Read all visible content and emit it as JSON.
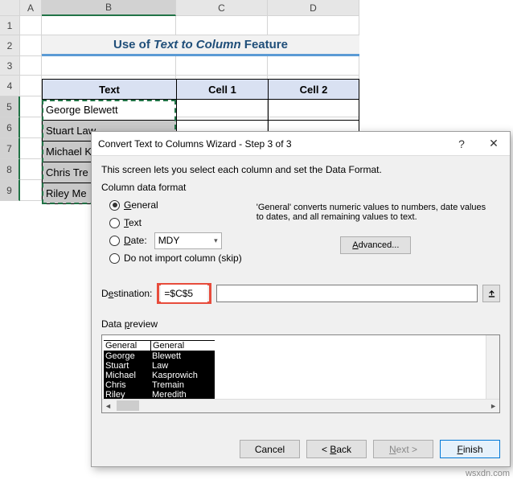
{
  "columns": {
    "a": "A",
    "b": "B",
    "c": "C",
    "d": "D"
  },
  "rows": [
    "1",
    "2",
    "3",
    "4",
    "5",
    "6",
    "7",
    "8",
    "9"
  ],
  "title": {
    "prefix": "Use of ",
    "italic": "Text to Column",
    "suffix": " Feature"
  },
  "headers": {
    "text": "Text",
    "cell1": "Cell 1",
    "cell2": "Cell 2"
  },
  "data_rows": [
    "George Blewett",
    "Stuart Law",
    "Michael Kasprowich",
    "Chris Tremain",
    "Riley Meredith"
  ],
  "data_visible": [
    "George Blewett",
    "Stuart Law",
    "Michael K",
    "Chris Tre",
    "Riley Me"
  ],
  "dialog": {
    "title": "Convert Text to Columns Wizard - Step 3 of 3",
    "help": "?",
    "close": "✕",
    "instruction": "This screen lets you select each column and set the Data Format.",
    "format_label": "Column data format",
    "radios": {
      "general": "General",
      "text": "Text",
      "date": "Date:",
      "skip": "Do not import column (skip)"
    },
    "date_value": "MDY",
    "desc": "'General' converts numeric values to numbers, date values to dates, and all remaining values to text.",
    "advanced": "Advanced...",
    "dest_label": "Destination:",
    "dest_value": "=$C$5",
    "preview_label": "Data preview",
    "preview_headers": [
      "General",
      "General"
    ],
    "preview_data": [
      [
        "George",
        "Blewett"
      ],
      [
        "Stuart",
        "Law"
      ],
      [
        "Michael",
        "Kasprowich"
      ],
      [
        "Chris",
        "Tremain"
      ],
      [
        "Riley",
        "Meredith"
      ]
    ],
    "buttons": {
      "cancel": "Cancel",
      "back": "< Back",
      "next": "Next >",
      "finish": "Finish"
    }
  },
  "watermark": "wsxdn.com"
}
